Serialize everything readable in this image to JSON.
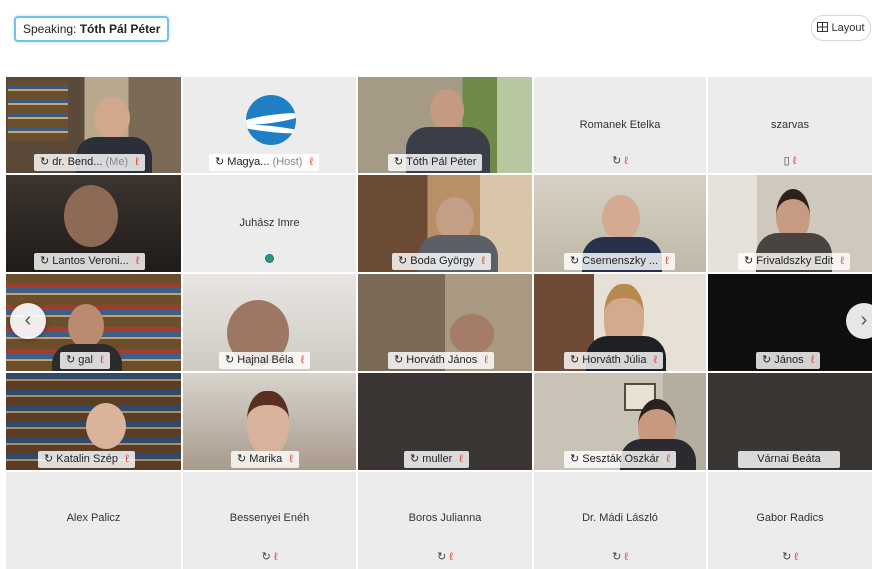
{
  "toolbar": {
    "speaking_prefix": "Speaking:",
    "speaking_name": "Tóth Pál Péter",
    "layout_label": "Layout",
    "layout_icon": "grid-layout-icon"
  },
  "icons": {
    "audio": "↻",
    "mic_muted": "ℓ",
    "phone": "▯"
  },
  "tiles": {
    "r1": [
      {
        "name": "dr. Bend...",
        "tag": "(Me)"
      },
      {
        "name": "Magya...",
        "tag": "(Host)"
      },
      {
        "name": "Tóth Pál Péter"
      },
      {
        "name": "Romanek Etelka"
      },
      {
        "name": "szarvas"
      }
    ],
    "r2": [
      {
        "name": "Lantos Veroni..."
      },
      {
        "name": "Juhász Imre"
      },
      {
        "name": "Boda György"
      },
      {
        "name": "Csernenszky ..."
      },
      {
        "name": "Frivaldszky Edit"
      }
    ],
    "r3": [
      {
        "name": "gal"
      },
      {
        "name": "Hajnal Béla"
      },
      {
        "name": "Horváth János"
      },
      {
        "name": "Horváth Júlia"
      },
      {
        "name": "János"
      }
    ],
    "r4": [
      {
        "name": "Katalin Szép"
      },
      {
        "name": "Marika"
      },
      {
        "name": "muller"
      },
      {
        "name": "Seszták Oszkár"
      },
      {
        "name": "Várnai Beáta"
      }
    ],
    "r5": [
      {
        "name": "Alex Palicz"
      },
      {
        "name": "Bessenyei Enéh"
      },
      {
        "name": "Boros Julianna"
      },
      {
        "name": "Dr. Mádi László"
      },
      {
        "name": "Gabor Radics"
      }
    ]
  }
}
